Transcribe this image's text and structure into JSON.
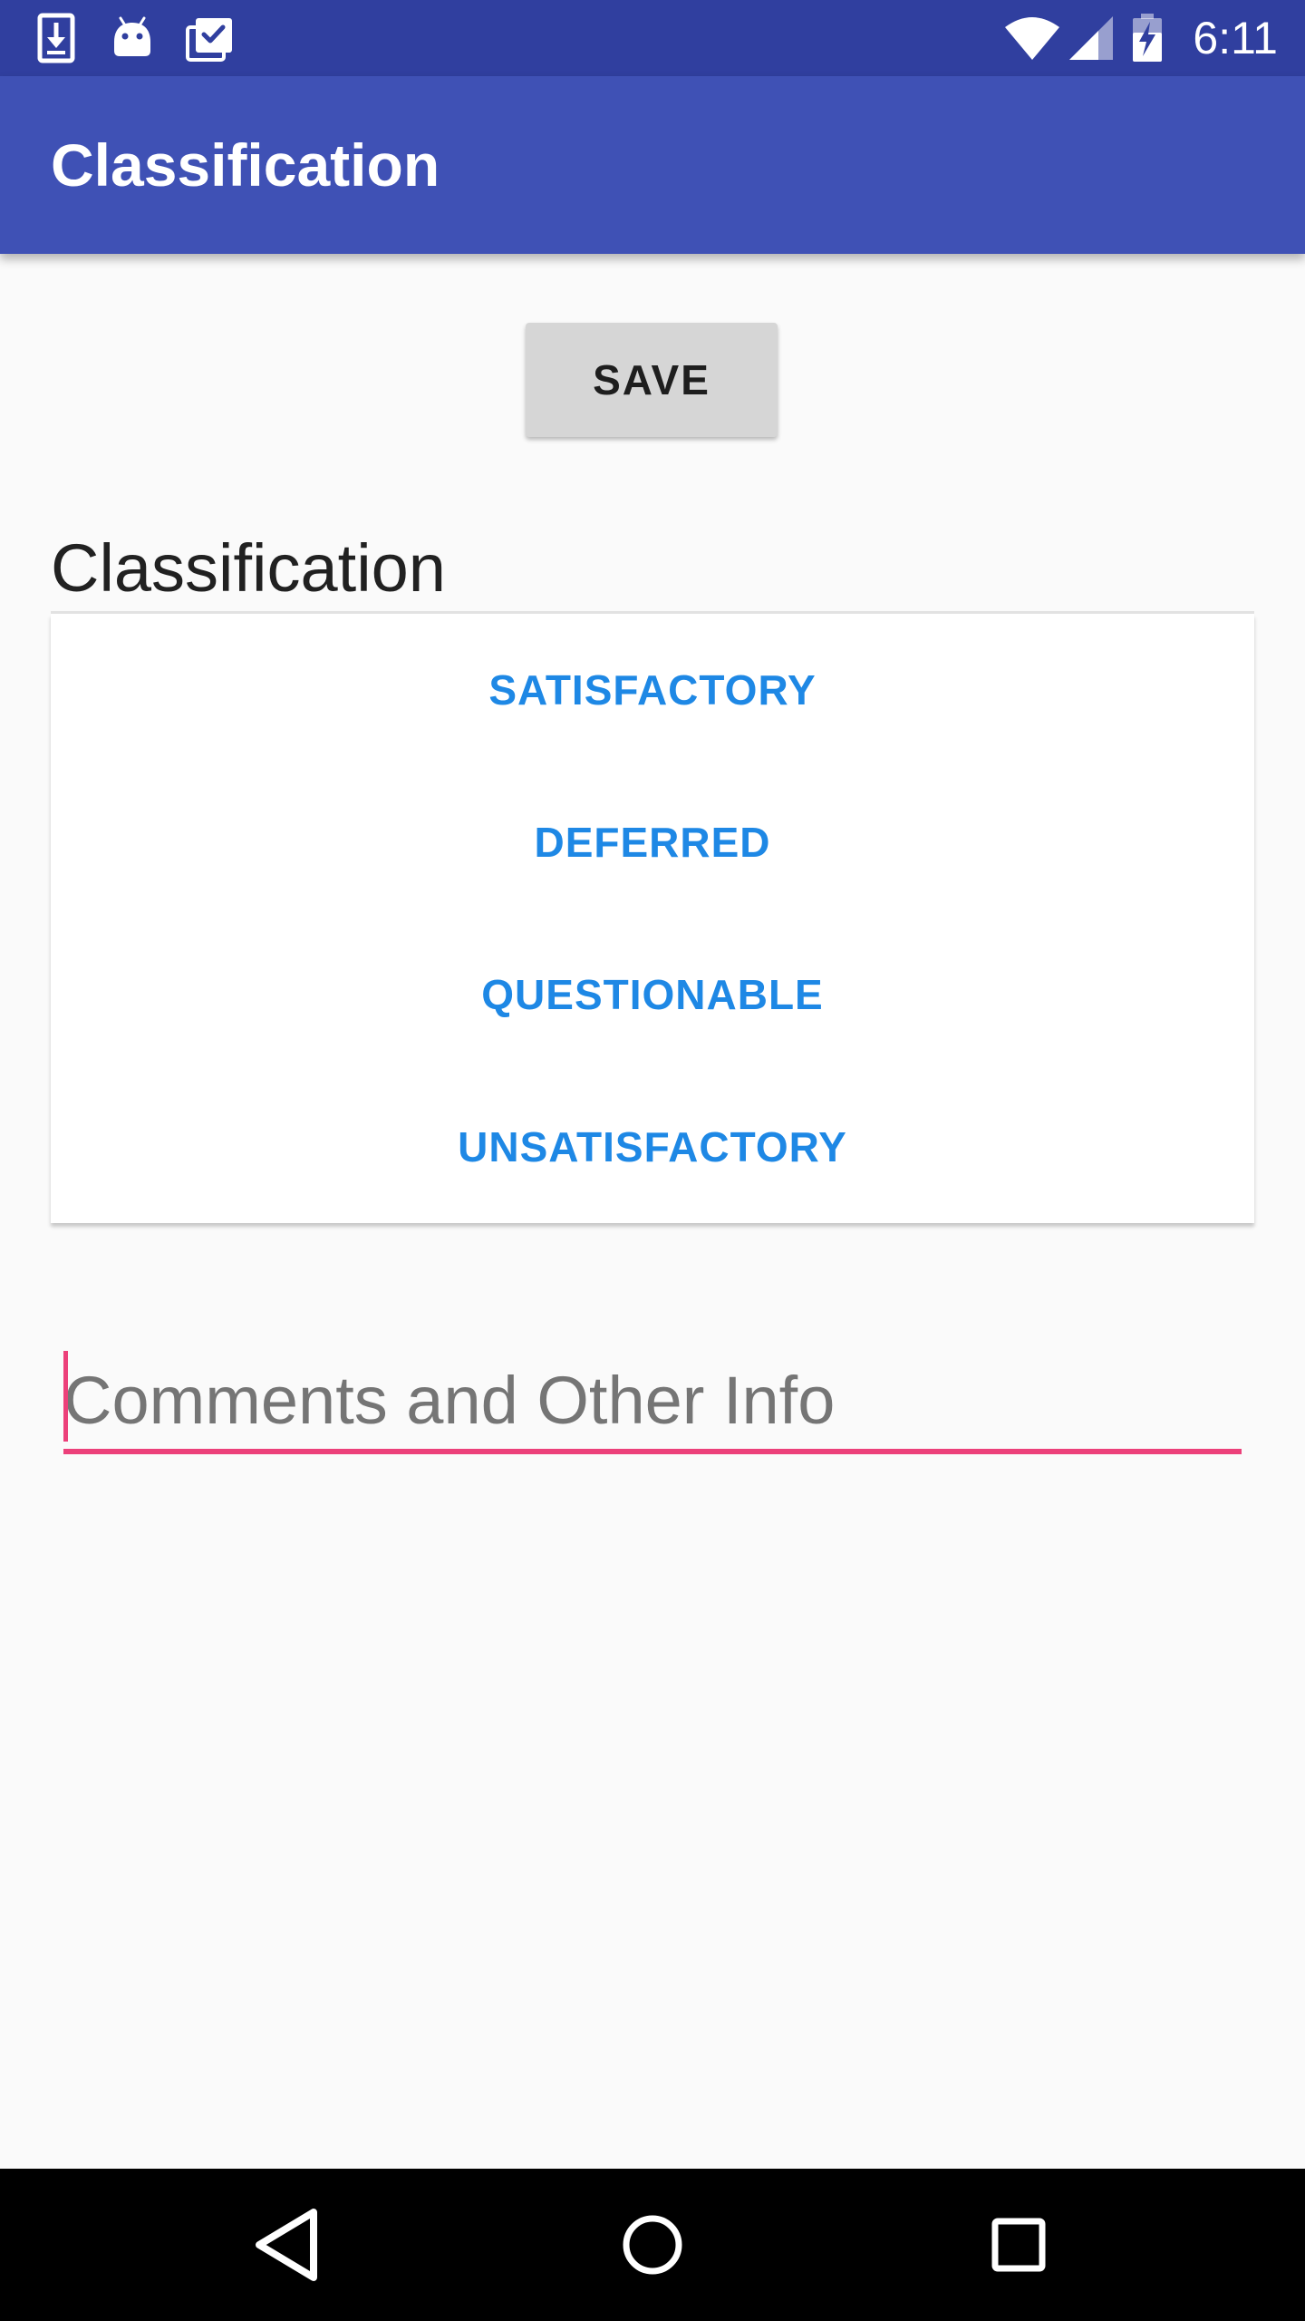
{
  "status_bar": {
    "time": "6:11",
    "left_icons": [
      "download-icon",
      "android-icon",
      "clipboard-check-icon"
    ],
    "right_icons": [
      "wifi-icon",
      "signal-icon",
      "battery-charging-icon"
    ],
    "background_color": "#303f9f"
  },
  "app_bar": {
    "title": "Classification",
    "background_color": "#3f51b5"
  },
  "save_button": {
    "label": "SAVE"
  },
  "classification": {
    "heading": "Classification",
    "options": [
      {
        "label": "SATISFACTORY"
      },
      {
        "label": "DEFERRED"
      },
      {
        "label": "QUESTIONABLE"
      },
      {
        "label": "UNSATISFACTORY"
      }
    ],
    "option_color": "#1e88e5"
  },
  "comments": {
    "value": "",
    "placeholder": "Comments and Other Info",
    "accent_color": "#ec407a"
  },
  "nav_bar": {
    "buttons": [
      "back-icon",
      "home-icon",
      "recents-icon"
    ]
  }
}
